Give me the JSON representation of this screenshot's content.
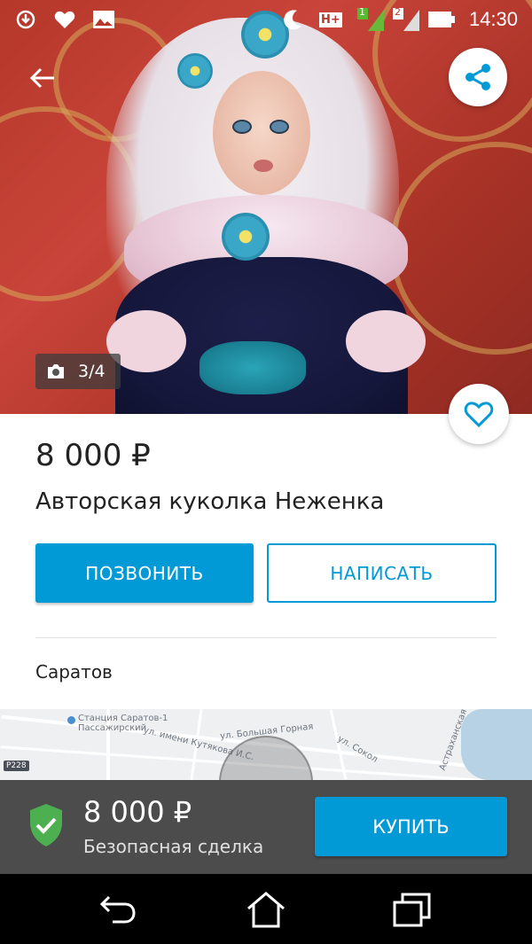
{
  "status_bar": {
    "time": "14:30",
    "network_label": "H+",
    "sim1": "1",
    "sim2": "2",
    "icons": [
      "download-icon",
      "heart-icon",
      "image-icon",
      "moon-icon",
      "network-icon",
      "signal-icon",
      "battery-icon"
    ]
  },
  "gallery": {
    "counter": "3/4",
    "current": 3,
    "total": 4
  },
  "listing": {
    "price": "8 000 ₽",
    "title": "Авторская куколка Неженка",
    "city": "Саратов"
  },
  "actions": {
    "call_label": "ПОЗВОНИТЬ",
    "write_label": "НАПИСАТЬ"
  },
  "map": {
    "labels": {
      "station": "Станция Саратов-1",
      "station_sub": "Пассажирский",
      "street_bolshaya": "ул. Большая Горная",
      "street_kutyakova": "ул. имени Кутякова И.С.",
      "street_sokol": "ул. Сокол",
      "street_astra": "Астраханская ул",
      "road_badge": "Р228"
    }
  },
  "buy_bar": {
    "price": "8 000 ₽",
    "safe_deal": "Безопасная сделка",
    "buy_label": "КУПИТЬ"
  },
  "colors": {
    "accent": "#0199d6",
    "buy_bar_bg": "#4c4c4c",
    "shield": "#4caf50"
  }
}
